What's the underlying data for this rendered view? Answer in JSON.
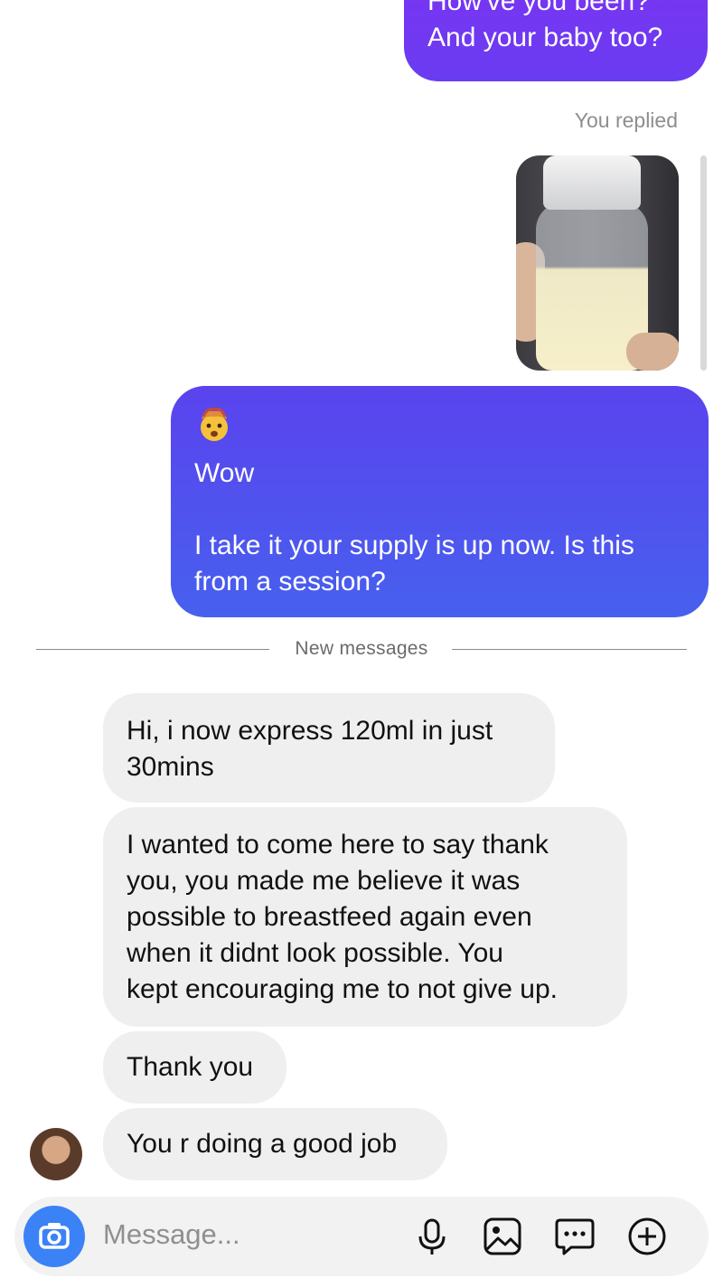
{
  "thread": {
    "sent_top": {
      "line1": "How've you been?",
      "line2": "And your baby too?"
    },
    "reply_meta": "You replied",
    "sent_big": {
      "emoji_name": "exploding-head",
      "line1": "Wow",
      "line2": "I take it your supply is up now. Is this",
      "line3": "from a session?"
    },
    "divider_label": "New messages",
    "received": [
      {
        "lines": [
          "Hi, i now express 120ml in just",
          "30mins"
        ]
      },
      {
        "lines": [
          "I wanted to come here to say thank",
          "you, you made me believe it was",
          "possible to breastfeed again even",
          "when it didnt look possible. You",
          "kept encouraging me to not give up."
        ]
      },
      {
        "lines": [
          "Thank you"
        ]
      },
      {
        "lines": [
          "You r doing a good job"
        ]
      }
    ]
  },
  "composer": {
    "placeholder": "Message...",
    "icons": [
      "camera-icon",
      "microphone-icon",
      "image-icon",
      "sticker-chat-icon",
      "plus-icon"
    ]
  },
  "colors": {
    "sent_gradient_top": "#7b33f2",
    "sent_gradient_bottom": "#4760ee",
    "received_bubble": "#efefef",
    "camera_button": "#3b82f6"
  }
}
